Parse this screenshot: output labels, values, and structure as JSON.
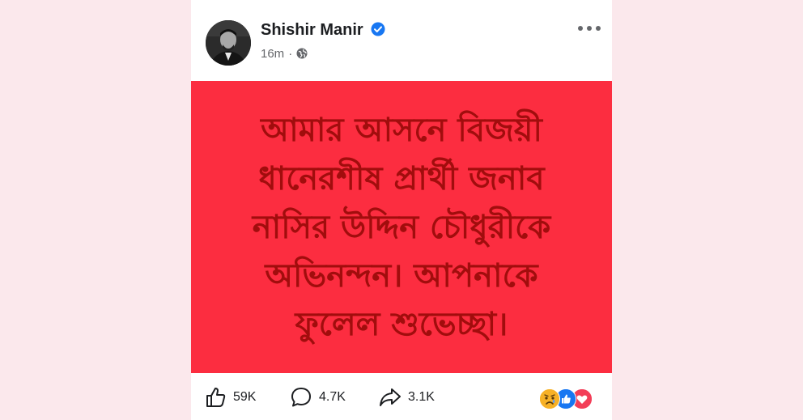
{
  "post": {
    "author": "Shishir Manir",
    "time": "16m",
    "separator": "·",
    "text": "আমার আসনে বিজয়ী\nধানেরশীষ প্রার্থী জনাব\nনাসির উদ্দিন চৌধুরীকে\nঅভিনন্দন। আপনাকে\nফুলেল শুভেচ্ছা।",
    "background_color": "#fc2d40",
    "text_color": "#a10d0d"
  },
  "footer": {
    "likes": "59K",
    "comments": "4.7K",
    "shares": "3.1K",
    "reaction_icons": [
      "sad-reaction-icon",
      "like-reaction-icon",
      "love-reaction-icon"
    ]
  },
  "colors": {
    "page_background": "#fbe8ec",
    "verified_blue": "#1877f2",
    "meta_grey": "#65676b"
  }
}
